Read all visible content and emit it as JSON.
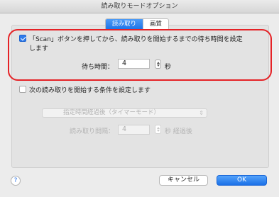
{
  "window": {
    "title": "読み取りモードオプション"
  },
  "tabs": [
    {
      "label": "読み取り",
      "active": true
    },
    {
      "label": "画質",
      "active": false
    }
  ],
  "wait_option": {
    "checked": true,
    "label_line1": "「Scan」ボタンを押してから、読み取りを開始するまでの待ち時間を設定",
    "label_line2": "します",
    "time_label": "待ち時間：",
    "time_value": "4",
    "unit": "秒"
  },
  "next_option": {
    "checked": false,
    "label": "次の読み取りを開始する条件を設定します",
    "mode_selected": "指定時間経過後（タイマーモード）",
    "interval_label": "読み取り間隔：",
    "interval_value": "4",
    "interval_unit": "秒 経過後"
  },
  "footer": {
    "help": "?",
    "cancel_label": "キャンセル",
    "ok_label": "OK"
  },
  "colors": {
    "accent": "#1a72e8",
    "highlight": "#e52226"
  }
}
